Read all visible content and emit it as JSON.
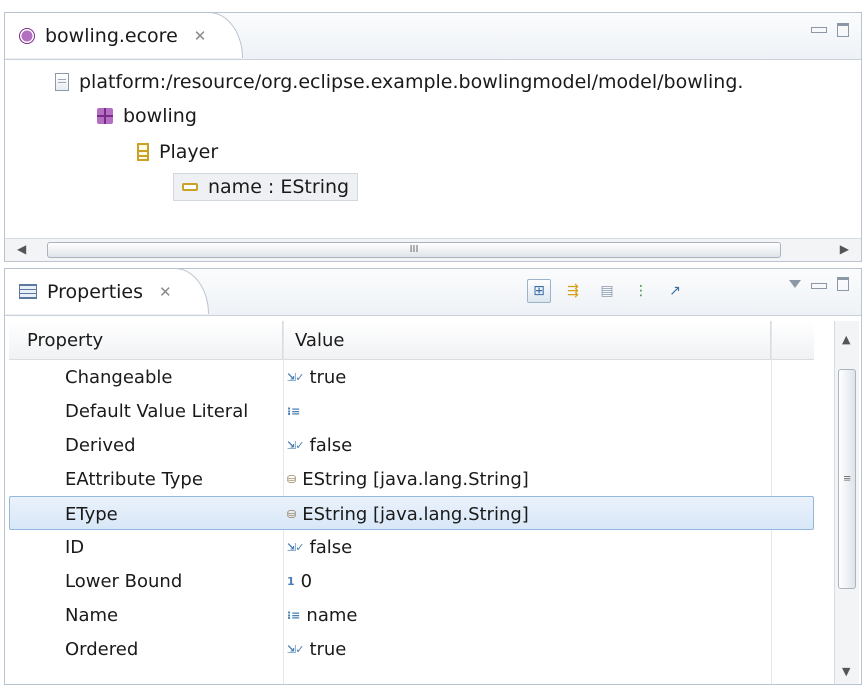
{
  "editor": {
    "tab_label": "bowling.ecore",
    "tab_close": "✕",
    "resource_uri": "platform:/resource/org.eclipse.example.bowlingmodel/model/bowling.",
    "package_name": "bowling",
    "class_name": "Player",
    "attribute_label": "name : EString",
    "scroll_left": "◀",
    "scroll_right": "▶",
    "scroll_grip": "III"
  },
  "properties": {
    "tab_label": "Properties",
    "tab_close": "✕",
    "columns": {
      "property": "Property",
      "value": "Value"
    },
    "rows": [
      {
        "property": "Changeable",
        "value": "true",
        "icon": "boolean-icon"
      },
      {
        "property": "Default Value Literal",
        "value": "",
        "icon": "text-icon"
      },
      {
        "property": "Derived",
        "value": "false",
        "icon": "boolean-icon"
      },
      {
        "property": "EAttribute Type",
        "value": "EString [java.lang.String]",
        "icon": "type-icon"
      },
      {
        "property": "EType",
        "value": "EString [java.lang.String]",
        "icon": "type-icon",
        "selected": true
      },
      {
        "property": "ID",
        "value": "false",
        "icon": "boolean-icon"
      },
      {
        "property": "Lower Bound",
        "value": "0",
        "icon": "number-icon"
      },
      {
        "property": "Name",
        "value": "name",
        "icon": "text-icon"
      },
      {
        "property": "Ordered",
        "value": "true",
        "icon": "boolean-icon"
      }
    ],
    "scroll_up": "▲",
    "scroll_down": "▼",
    "scroll_grip": "≡"
  },
  "icon_glyphs": {
    "bool": "⇲✓",
    "text": "⁝≡",
    "type": "⛁",
    "num": "1"
  },
  "colors": {
    "selection_border": "#95b8de",
    "selection_fill": "#d8e7f7",
    "panel_border": "#b9c4d0"
  }
}
